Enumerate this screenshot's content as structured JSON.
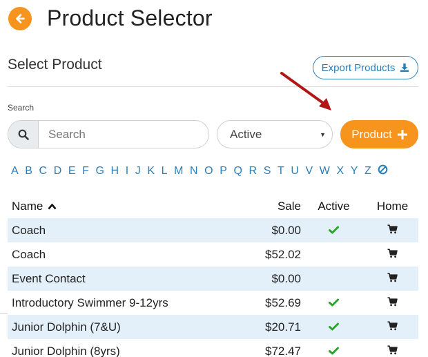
{
  "header": {
    "title": "Product Selector",
    "back_icon": "arrow-left-icon"
  },
  "section": {
    "title": "Select Product",
    "export_label": "Export Products",
    "export_icon": "download-icon"
  },
  "search": {
    "label": "Search",
    "placeholder": "Search",
    "value": "",
    "icon": "search-icon"
  },
  "status_filter": {
    "selected": "Active",
    "caret": "▼"
  },
  "add_button": {
    "label": "Product",
    "icon": "plus-icon"
  },
  "alphabet": [
    "A",
    "B",
    "C",
    "D",
    "E",
    "F",
    "G",
    "H",
    "I",
    "J",
    "K",
    "L",
    "M",
    "N",
    "O",
    "P",
    "Q",
    "R",
    "S",
    "T",
    "U",
    "V",
    "W",
    "X",
    "Y",
    "Z"
  ],
  "table": {
    "columns": {
      "name": "Name",
      "sale": "Sale",
      "active": "Active",
      "home": "Home"
    },
    "rows": [
      {
        "name": "Coach",
        "sale": "$0.00",
        "active": true
      },
      {
        "name": "Coach",
        "sale": "$52.02",
        "active": false
      },
      {
        "name": "Event Contact",
        "sale": "$0.00",
        "active": false
      },
      {
        "name": "Introductory Swimmer 9-12yrs",
        "sale": "$52.69",
        "active": true
      },
      {
        "name": "Junior Dolphin (7&U)",
        "sale": "$20.71",
        "active": true
      },
      {
        "name": "Junior Dolphin (8yrs)",
        "sale": "$72.47",
        "active": true
      }
    ]
  },
  "colors": {
    "accent": "#f7941d",
    "link": "#2a7fba",
    "stripe": "#e3f0f9",
    "check": "#2aa52a",
    "arrow": "#b01818"
  }
}
